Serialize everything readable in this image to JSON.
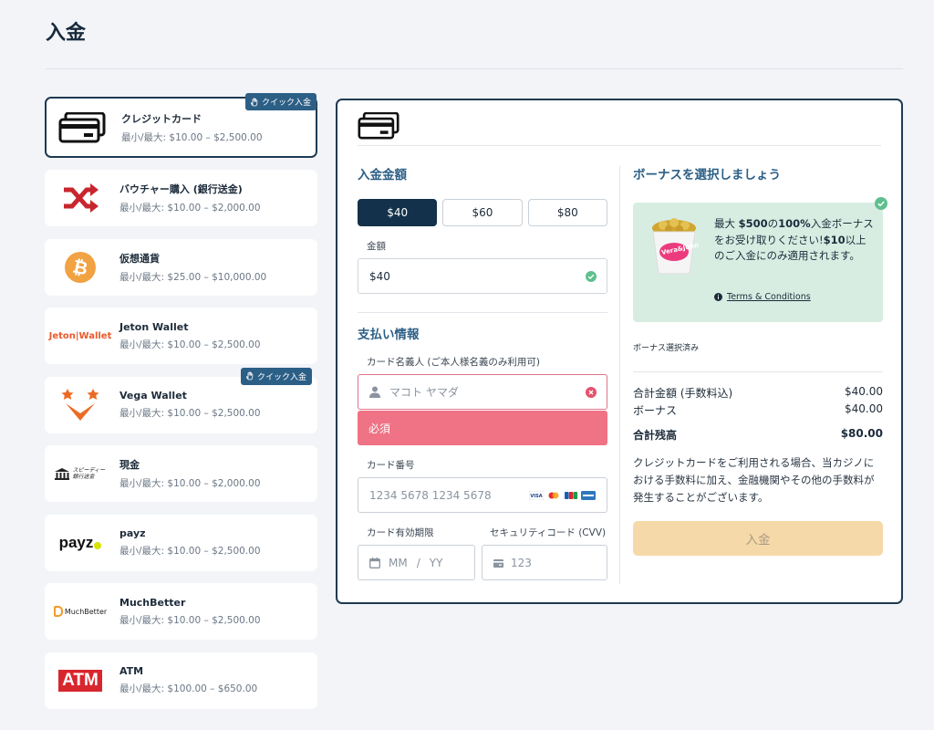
{
  "page": {
    "title": "入金"
  },
  "methods": [
    {
      "name": "クレジットカード",
      "range": "最小/最大: $10.00 – $2,500.00",
      "badge": "クイック入金",
      "icon": "credit-card-icon",
      "active": true
    },
    {
      "name": "バウチャー購入 (銀行送金)",
      "range": "最小/最大: $10.00 – $2,000.00",
      "icon": "voucher-shuffle-icon"
    },
    {
      "name": "仮想通貨",
      "range": "最小/最大: $25.00 – $10,000.00",
      "icon": "bitcoin-icon"
    },
    {
      "name": "Jeton Wallet",
      "range": "最小/最大: $10.00 – $2,500.00",
      "icon": "jeton-logo",
      "logo_text": "Jeton|Wallet"
    },
    {
      "name": "Vega Wallet",
      "range": "最小/最大: $10.00 – $2,500.00",
      "badge": "クイック入金",
      "icon": "vega-wallet-logo"
    },
    {
      "name": "現金",
      "range": "最小/最大: $10.00 – $2,000.00",
      "icon": "bank-icon",
      "logo_text": "スピーディー銀行送金"
    },
    {
      "name": "payz",
      "range": "最小/最大: $10.00 – $2,500.00",
      "icon": "payz-logo",
      "logo_text": "payz"
    },
    {
      "name": "MuchBetter",
      "range": "最小/最大: $10.00 – $2,500.00",
      "icon": "muchbetter-logo",
      "logo_text": "MuchBetter"
    },
    {
      "name": "ATM",
      "range": "最小/最大: $100.00 – $650.00",
      "icon": "atm-logo",
      "logo_text": "ATM"
    }
  ],
  "deposit": {
    "amount_title": "入金金額",
    "presets": [
      "$40",
      "$60",
      "$80"
    ],
    "selected_preset": 0,
    "amount_label": "金額",
    "amount_value": "$40",
    "payment_title": "支払い情報",
    "holder_label": "カード名義人 (ご本人様名義のみ利用可)",
    "holder_placeholder": "マコト ヤマダ",
    "holder_error": "必須",
    "card_label": "カード番号",
    "card_placeholder": "1234 5678 1234 5678",
    "card_brands": [
      "VISA",
      "Mastercard",
      "JCB",
      "Amex"
    ],
    "expiry_label": "カード有効期限",
    "expiry_mm": "MM",
    "expiry_slash": "/",
    "expiry_yy": "YY",
    "cvv_label": "セキュリティコード (CVV)",
    "cvv_placeholder": "123"
  },
  "bonus": {
    "title": "ボーナスを選択しましょう",
    "line1_pre": "最大 ",
    "line1_amount": "$500",
    "line1_mid": "の",
    "line1_pct": "100%",
    "line1_post": "入金ボーナスをお受け取りください!",
    "line2_amount": "$10",
    "line2_post": "以上のご入金にのみ適用されます。",
    "terms": "Terms & Conditions",
    "status": "ボーナス選択済み",
    "image_label": "Vera&John"
  },
  "summary": {
    "total_label": "合計金額 (手数料込)",
    "total_value": "$40.00",
    "bonus_label": "ボーナス",
    "bonus_value": "$40.00",
    "balance_label": "合計残高",
    "balance_value": "$80.00",
    "note": "クレジットカードをご利用される場合、当カジノにおける手数料に加え、金融機関やその他の手数料が発生することがございます。",
    "submit_label": "入金"
  },
  "colors": {
    "navy": "#13314a",
    "accent": "#2c5f86",
    "error": "#ef7285",
    "bonus_bg": "#d7ede2",
    "button_disabled": "#f6d9a8"
  }
}
